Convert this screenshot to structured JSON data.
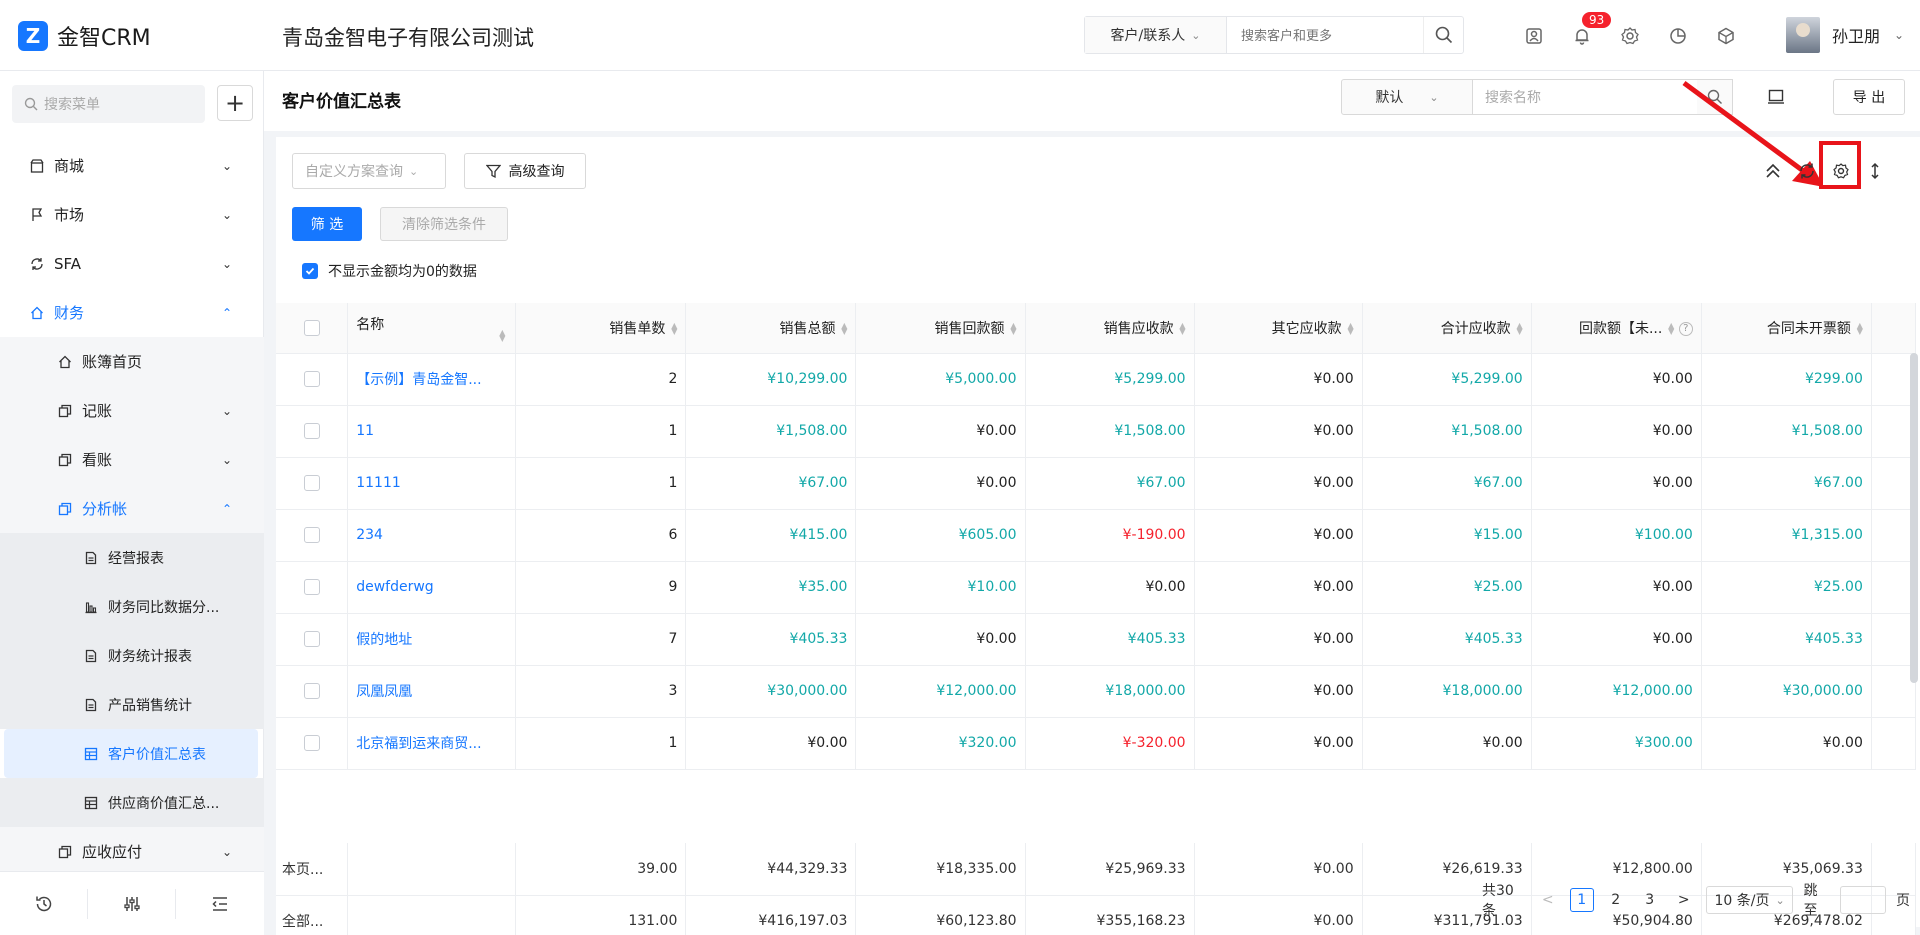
{
  "app": {
    "logo_mark": "Z",
    "name": "金智CRM",
    "company": "青岛金智电子有限公司测试"
  },
  "top_search": {
    "scope": "客户/联系人",
    "placeholder": "搜索客户和更多"
  },
  "notifications": {
    "count": "93"
  },
  "user": {
    "name": "孙卫朋"
  },
  "sidebar": {
    "search_placeholder": "搜索菜单",
    "add": "+",
    "items": [
      {
        "label": "商城",
        "icon": "shop-icon",
        "level": 1,
        "arrow": "⌄"
      },
      {
        "label": "市场",
        "icon": "flag-icon",
        "level": 1,
        "arrow": "⌄"
      },
      {
        "label": "SFA",
        "icon": "sync-icon",
        "level": 1,
        "arrow": "⌄"
      },
      {
        "label": "财务",
        "icon": "home-icon",
        "level": 1,
        "arrow": "⌃"
      },
      {
        "label": "账簿首页",
        "icon": "home-icon",
        "level": 2
      },
      {
        "label": "记账",
        "icon": "copy-icon",
        "level": 2,
        "arrow": "⌄"
      },
      {
        "label": "看账",
        "icon": "copy-icon",
        "level": 2,
        "arrow": "⌄"
      },
      {
        "label": "分析帐",
        "icon": "copy-icon",
        "level": 2,
        "arrow": "⌃"
      },
      {
        "label": "经营报表",
        "icon": "report-icon",
        "level": 3
      },
      {
        "label": "财务同比数据分...",
        "icon": "bar-chart-icon",
        "level": 3
      },
      {
        "label": "财务统计报表",
        "icon": "report-icon",
        "level": 3
      },
      {
        "label": "产品销售统计",
        "icon": "report-icon",
        "level": 3
      },
      {
        "label": "客户价值汇总表",
        "icon": "table-icon",
        "level": 3
      },
      {
        "label": "供应商价值汇总...",
        "icon": "table-icon",
        "level": 3
      },
      {
        "label": "应收应付",
        "icon": "copy-icon",
        "level": 2,
        "arrow": "⌄"
      }
    ]
  },
  "page": {
    "title": "客户价值汇总表",
    "view_select": "默认",
    "name_search_placeholder": "搜索名称",
    "export": "导 出",
    "scheme_placeholder": "自定义方案查询",
    "advanced_query": "高级查询",
    "filter": "筛 选",
    "clear_filter": "清除筛选条件",
    "hide_zero": "不显示金额均为0的数据"
  },
  "table": {
    "columns": [
      "名称",
      "销售单数",
      "销售总额",
      "销售回款额",
      "销售应收款",
      "其它应收款",
      "合计应收款",
      "回款额【未...",
      "合同未开票额"
    ],
    "rows": [
      [
        "【示例】青岛金智...",
        "2",
        "¥10,299.00",
        "¥5,000.00",
        "¥5,299.00",
        "¥0.00",
        "¥5,299.00",
        "¥0.00",
        "¥299.00"
      ],
      [
        "11",
        "1",
        "¥1,508.00",
        "¥0.00",
        "¥1,508.00",
        "¥0.00",
        "¥1,508.00",
        "¥0.00",
        "¥1,508.00"
      ],
      [
        "11111",
        "1",
        "¥67.00",
        "¥0.00",
        "¥67.00",
        "¥0.00",
        "¥67.00",
        "¥0.00",
        "¥67.00"
      ],
      [
        "234",
        "6",
        "¥415.00",
        "¥605.00",
        "¥-190.00",
        "¥0.00",
        "¥15.00",
        "¥100.00",
        "¥1,315.00"
      ],
      [
        "dewfderwg",
        "9",
        "¥35.00",
        "¥10.00",
        "¥0.00",
        "¥0.00",
        "¥25.00",
        "¥0.00",
        "¥25.00"
      ],
      [
        "假的地址",
        "7",
        "¥405.33",
        "¥0.00",
        "¥405.33",
        "¥0.00",
        "¥405.33",
        "¥0.00",
        "¥405.33"
      ],
      [
        "凤凰凤凰",
        "3",
        "¥30,000.00",
        "¥12,000.00",
        "¥18,000.00",
        "¥0.00",
        "¥18,000.00",
        "¥12,000.00",
        "¥30,000.00"
      ],
      [
        "北京福到运来商贸...",
        "1",
        "¥0.00",
        "¥320.00",
        "¥-320.00",
        "¥0.00",
        "¥0.00",
        "¥300.00",
        "¥0.00"
      ]
    ],
    "row_colors": [
      [
        "",
        "t",
        "t",
        "t",
        "",
        "t",
        "",
        "t"
      ],
      [
        "",
        "t",
        "",
        "t",
        "",
        "t",
        "",
        "t"
      ],
      [
        "",
        "t",
        "",
        "t",
        "",
        "t",
        "",
        "t"
      ],
      [
        "",
        "t",
        "t",
        "r",
        "",
        "t",
        "t",
        "t"
      ],
      [
        "",
        "t",
        "t",
        "",
        "",
        "t",
        "",
        "t"
      ],
      [
        "",
        "t",
        "",
        "t",
        "",
        "t",
        "",
        "t"
      ],
      [
        "",
        "t",
        "t",
        "t",
        "",
        "t",
        "t",
        "t"
      ],
      [
        "",
        "",
        "t",
        "r",
        "",
        "",
        "t",
        ""
      ]
    ],
    "summary": [
      [
        "本页...",
        "",
        "39.00",
        "¥44,329.33",
        "¥18,335.00",
        "¥25,969.33",
        "¥0.00",
        "¥26,619.33",
        "¥12,800.00",
        "¥35,069.33"
      ],
      [
        "全部...",
        "",
        "131.00",
        "¥416,197.03",
        "¥60,123.80",
        "¥355,168.23",
        "¥0.00",
        "¥311,791.03",
        "¥50,904.80",
        "¥269,478.02"
      ]
    ]
  },
  "pagination": {
    "total": "共30条",
    "prev": "<",
    "pages": [
      "1",
      "2",
      "3"
    ],
    "current": "1",
    "next": ">",
    "size": "10 条/页",
    "jump": "跳至",
    "page_unit": "页"
  }
}
